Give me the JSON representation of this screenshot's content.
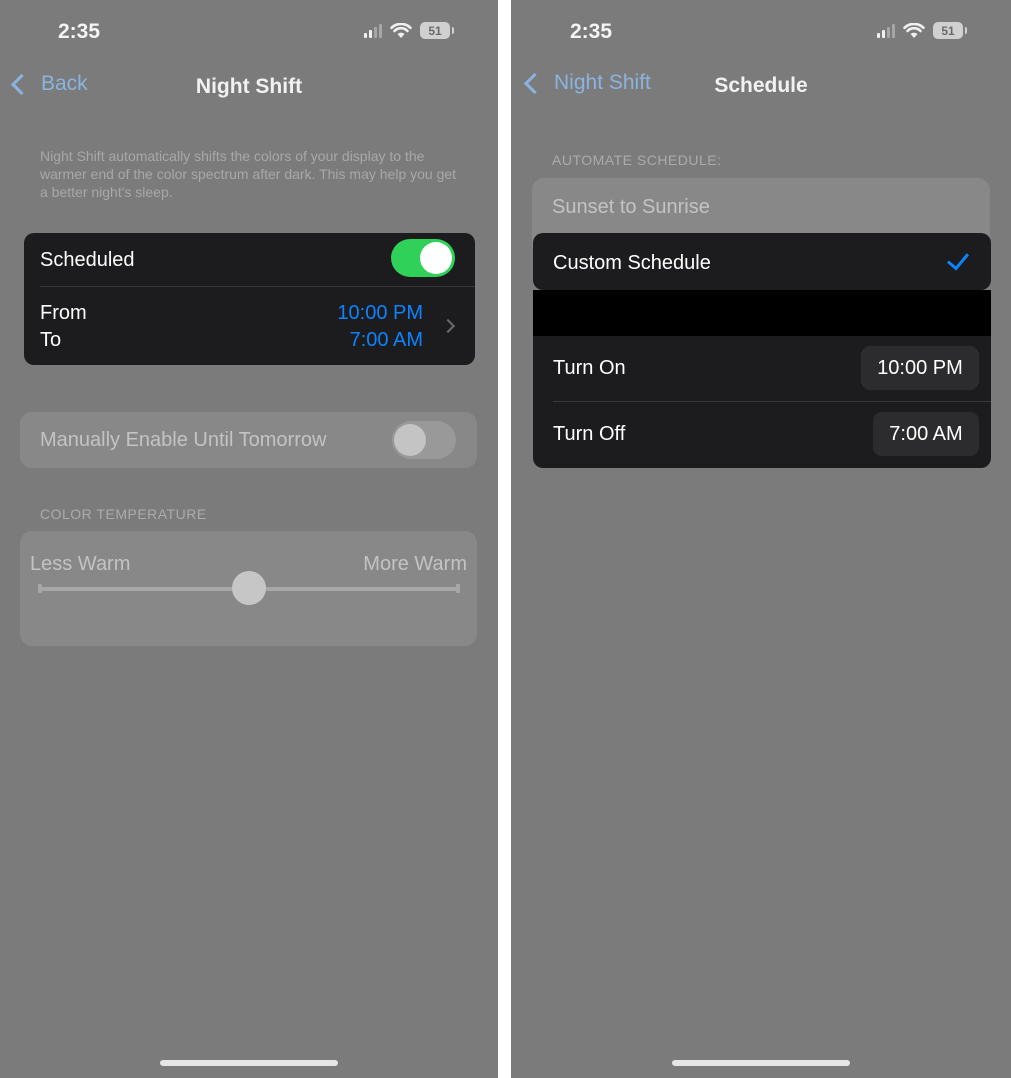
{
  "left": {
    "status": {
      "time": "2:35",
      "battery": "51"
    },
    "nav": {
      "back_label": "Back",
      "title": "Night Shift"
    },
    "description": "Night Shift automatically shifts the colors of your display to the warmer end of the color spectrum after dark. This may help you get a better night's sleep.",
    "scheduled": {
      "label": "Scheduled",
      "on": true
    },
    "from": {
      "label": "From",
      "value": "10:00 PM"
    },
    "to": {
      "label": "To",
      "value": "7:00 AM"
    },
    "manual": {
      "label": "Manually Enable Until Tomorrow",
      "on": false
    },
    "color_temperature": {
      "section_label": "COLOR TEMPERATURE",
      "less_label": "Less Warm",
      "more_label": "More Warm",
      "level": 0.5
    }
  },
  "right": {
    "status": {
      "time": "2:35",
      "battery": "51"
    },
    "nav": {
      "back_label": "Night Shift",
      "title": "Schedule"
    },
    "section_label": "AUTOMATE SCHEDULE:",
    "options": [
      {
        "label": "Sunset to Sunrise",
        "selected": false
      },
      {
        "label": "Custom Schedule",
        "selected": true
      }
    ],
    "turn_on": {
      "label": "Turn On",
      "value": "10:00 PM"
    },
    "turn_off": {
      "label": "Turn Off",
      "value": "7:00 AM"
    }
  },
  "colors": {
    "accent_blue": "#0a84ff",
    "toggle_green": "#30d158",
    "dim_overlay": "#7b7b7b",
    "card_dark": "#1c1c1e"
  }
}
